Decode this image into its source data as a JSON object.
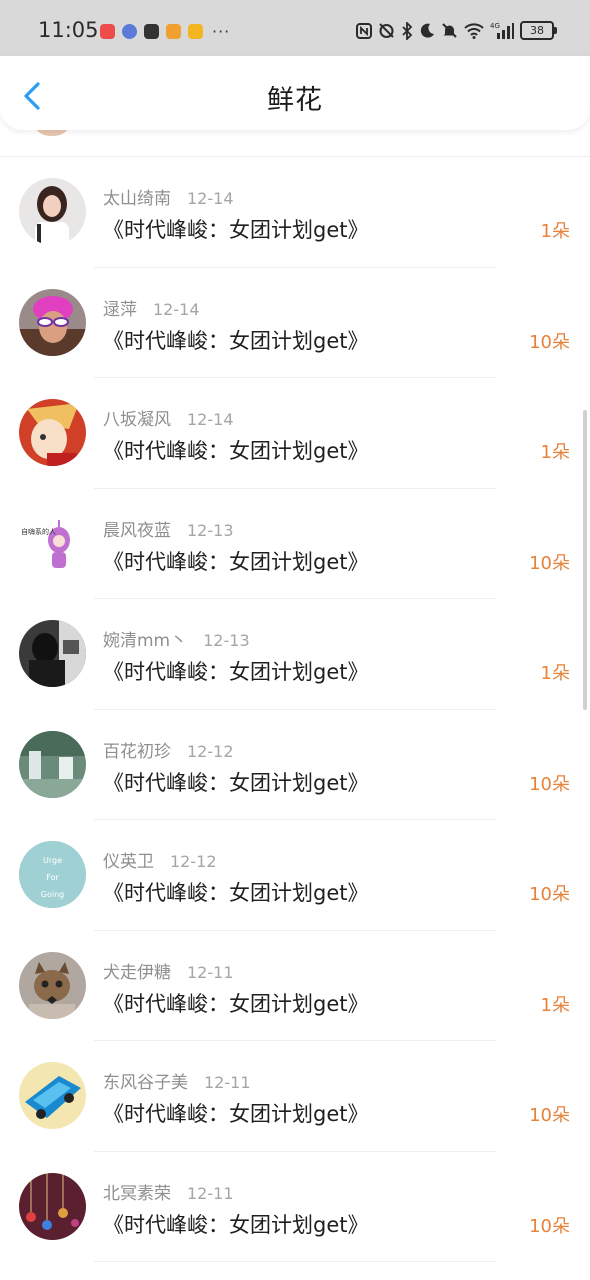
{
  "status_bar": {
    "time": "11:05",
    "more": "···",
    "battery": "38",
    "network": "4G"
  },
  "header": {
    "title": "鲜花",
    "back_icon": "chevron-left-icon"
  },
  "colors": {
    "accent_blue": "#2a9df4",
    "count_orange": "#e8823a",
    "statusbar_bg": "#d9d9d9"
  },
  "items": [
    {
      "name": "太山绮南",
      "date": "12-14",
      "book": "《时代峰峻：女团计划get》",
      "count": "1朵"
    },
    {
      "name": "逯萍",
      "date": "12-14",
      "book": "《时代峰峻：女团计划get》",
      "count": "10朵"
    },
    {
      "name": "八坂凝风",
      "date": "12-14",
      "book": "《时代峰峻：女团计划get》",
      "count": "1朵"
    },
    {
      "name": "晨风夜蓝",
      "date": "12-13",
      "book": "《时代峰峻：女团计划get》",
      "count": "10朵"
    },
    {
      "name": "婉清mm丶",
      "date": "12-13",
      "book": "《时代峰峻：女团计划get》",
      "count": "1朵"
    },
    {
      "name": "百花初珍",
      "date": "12-12",
      "book": "《时代峰峻：女团计划get》",
      "count": "10朵"
    },
    {
      "name": "仪英卫",
      "date": "12-12",
      "book": "《时代峰峻：女团计划get》",
      "count": "10朵"
    },
    {
      "name": "犬走伊糖",
      "date": "12-11",
      "book": "《时代峰峻：女团计划get》",
      "count": "1朵"
    },
    {
      "name": "东风谷子美",
      "date": "12-11",
      "book": "《时代峰峻：女团计划get》",
      "count": "10朵"
    },
    {
      "name": "北冥素荣",
      "date": "12-11",
      "book": "《时代峰峻：女团计划get》",
      "count": "10朵"
    }
  ],
  "avatar_texts": {
    "a4": "自嗨系的人",
    "a7_lines": [
      "Urge",
      "For",
      "Going"
    ]
  }
}
